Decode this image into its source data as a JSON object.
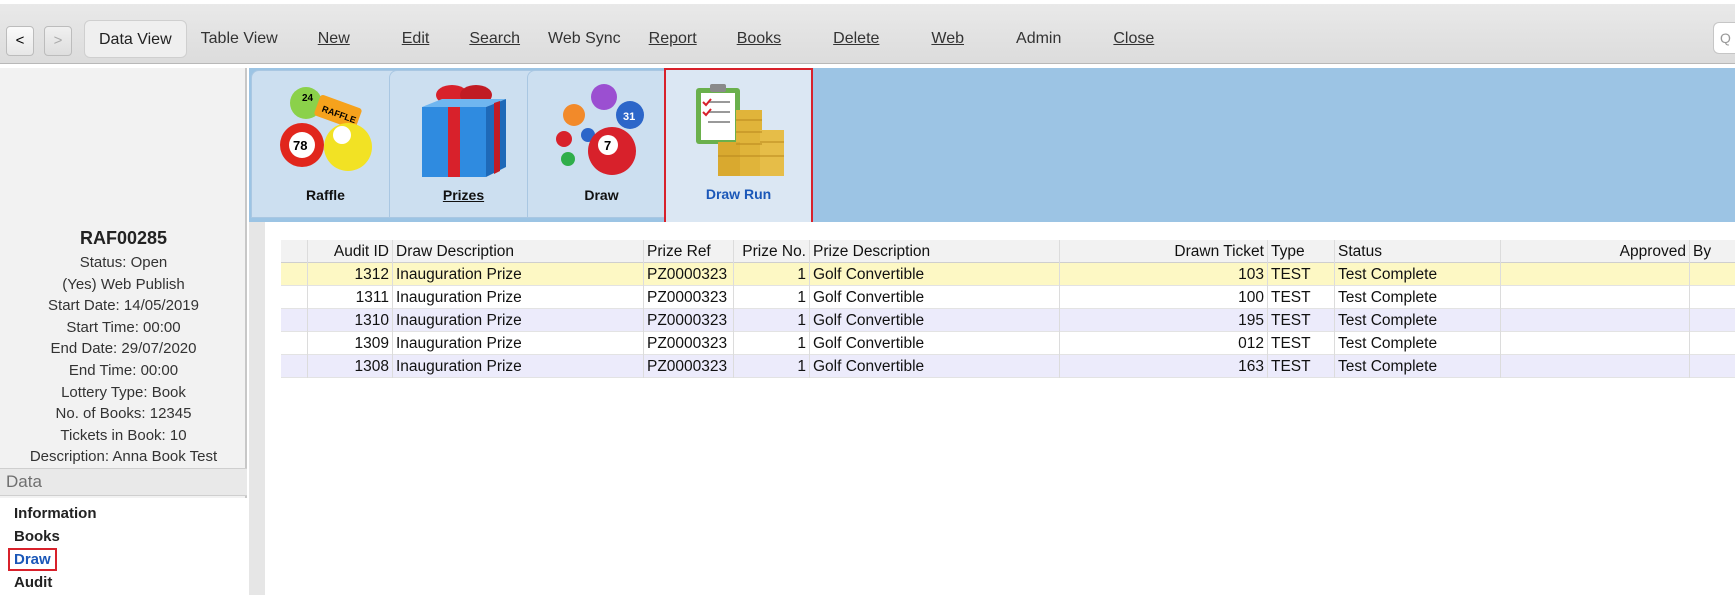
{
  "toolbar": {
    "back_label": "<",
    "forward_label": ">",
    "menu": [
      {
        "label": "Data View",
        "active": true,
        "underline": false
      },
      {
        "label": "Table View",
        "active": false,
        "underline": false
      },
      {
        "label": "New",
        "active": false,
        "underline": true
      },
      {
        "label": "Edit",
        "active": false,
        "underline": true
      },
      {
        "label": "Search",
        "active": false,
        "underline": true
      },
      {
        "label": "Web Sync",
        "active": false,
        "underline": false
      },
      {
        "label": "Report",
        "active": false,
        "underline": true
      },
      {
        "label": "Books",
        "active": false,
        "underline": true
      },
      {
        "label": "Delete",
        "active": false,
        "underline": true
      },
      {
        "label": "Web",
        "active": false,
        "underline": true
      },
      {
        "label": "Admin",
        "active": false,
        "underline": false
      },
      {
        "label": "Close",
        "active": false,
        "underline": true
      }
    ],
    "search_glyph": "Q"
  },
  "record": {
    "id": "RAF00285",
    "lines": [
      "Status: Open",
      "(Yes) Web Publish",
      "Start Date: 14/05/2019",
      "Start Time: 00:00",
      "End Date: 29/07/2020",
      "End Time: 00:00",
      "Lottery Type: Book",
      "No. of Books: 12345",
      "Tickets in Book: 10",
      "Description: Anna Book Test"
    ]
  },
  "data_section": {
    "header": "Data",
    "links": [
      {
        "label": "Information",
        "active": false
      },
      {
        "label": "Books",
        "active": false
      },
      {
        "label": "Draw",
        "active": true
      },
      {
        "label": "Audit",
        "active": false
      }
    ]
  },
  "tiles": [
    {
      "label": "Raffle",
      "icon": "raffle-balls-icon",
      "selected": false
    },
    {
      "label": "Prizes",
      "icon": "gift-box-icon",
      "selected": false
    },
    {
      "label": "Draw",
      "icon": "lottery-balls-icon",
      "selected": false
    },
    {
      "label": "Draw Run",
      "icon": "clipboard-coins-icon",
      "selected": true
    }
  ],
  "grid": {
    "columns": [
      "",
      "Audit ID",
      "Draw Description",
      "Prize Ref",
      "Prize No.",
      "Prize Description",
      "Drawn Ticket",
      "Type",
      "Status",
      "Approved",
      "By"
    ],
    "rows": [
      [
        "",
        "1312",
        "Inauguration Prize",
        "PZ0000323",
        "1",
        "Golf Convertible",
        "103",
        "TEST",
        "Test Complete",
        "",
        ""
      ],
      [
        "",
        "1311",
        "Inauguration Prize",
        "PZ0000323",
        "1",
        "Golf Convertible",
        "100",
        "TEST",
        "Test Complete",
        "",
        ""
      ],
      [
        "",
        "1310",
        "Inauguration Prize",
        "PZ0000323",
        "1",
        "Golf Convertible",
        "195",
        "TEST",
        "Test Complete",
        "",
        ""
      ],
      [
        "",
        "1309",
        "Inauguration Prize",
        "PZ0000323",
        "1",
        "Golf Convertible",
        "012",
        "TEST",
        "Test Complete",
        "",
        ""
      ],
      [
        "",
        "1308",
        "Inauguration Prize",
        "PZ0000323",
        "1",
        "Golf Convertible",
        "163",
        "TEST",
        "Test Complete",
        "",
        ""
      ]
    ]
  },
  "colors": {
    "tilebar_bg": "#9cc4e4",
    "selected_row": "#fdf8c4",
    "alt_row": "#ecebfb",
    "highlight_red": "#d8212b",
    "link_blue": "#1a57b8"
  }
}
